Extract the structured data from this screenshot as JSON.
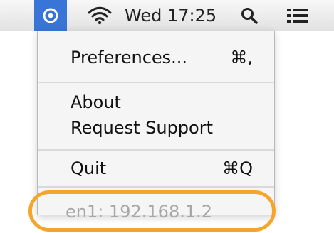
{
  "menu_bar": {
    "active_icon": "target-icon",
    "wifi_icon": "wifi-icon",
    "clock_text": "Wed 17:25",
    "search_icon": "search-icon",
    "list_icon": "list-icon"
  },
  "dropdown": {
    "preferences_label": "Preferences...",
    "preferences_shortcut": "⌘,",
    "about_label": "About",
    "request_support_label": "Request Support",
    "quit_label": "Quit",
    "quit_shortcut": "⌘Q",
    "ip_label": "en1: 192.168.1.2"
  },
  "colors": {
    "selected": "#3875d7",
    "highlight": "#f4a62a",
    "disabled_text": "#a7a7a7"
  }
}
